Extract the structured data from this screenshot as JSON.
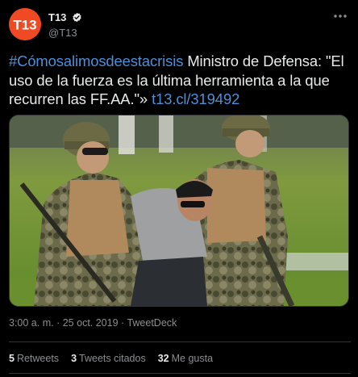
{
  "user": {
    "avatar_text": "T13",
    "display_name": "T13",
    "handle": "@T13",
    "verified": true,
    "avatar_color": "#ef4a23"
  },
  "tweet": {
    "hashtag": "#Cómosalimosdeestacrisis",
    "body": " Ministro de Defensa: \"El uso de la fuerza es la última herramienta a la que recurren las FF.AA.\"» ",
    "link": "t13.cl/319492",
    "link_color": "#4a90d9"
  },
  "meta": {
    "time": "3:00 a. m.",
    "date": "25 oct. 2019",
    "source": "TweetDeck",
    "separator": "·"
  },
  "stats": [
    {
      "count": "5",
      "label": "Retweets"
    },
    {
      "count": "3",
      "label": "Tweets citados"
    },
    {
      "count": "32",
      "label": "Me gusta"
    }
  ],
  "icons": {
    "more": "more-options-icon",
    "verified": "verified-badge-icon"
  }
}
